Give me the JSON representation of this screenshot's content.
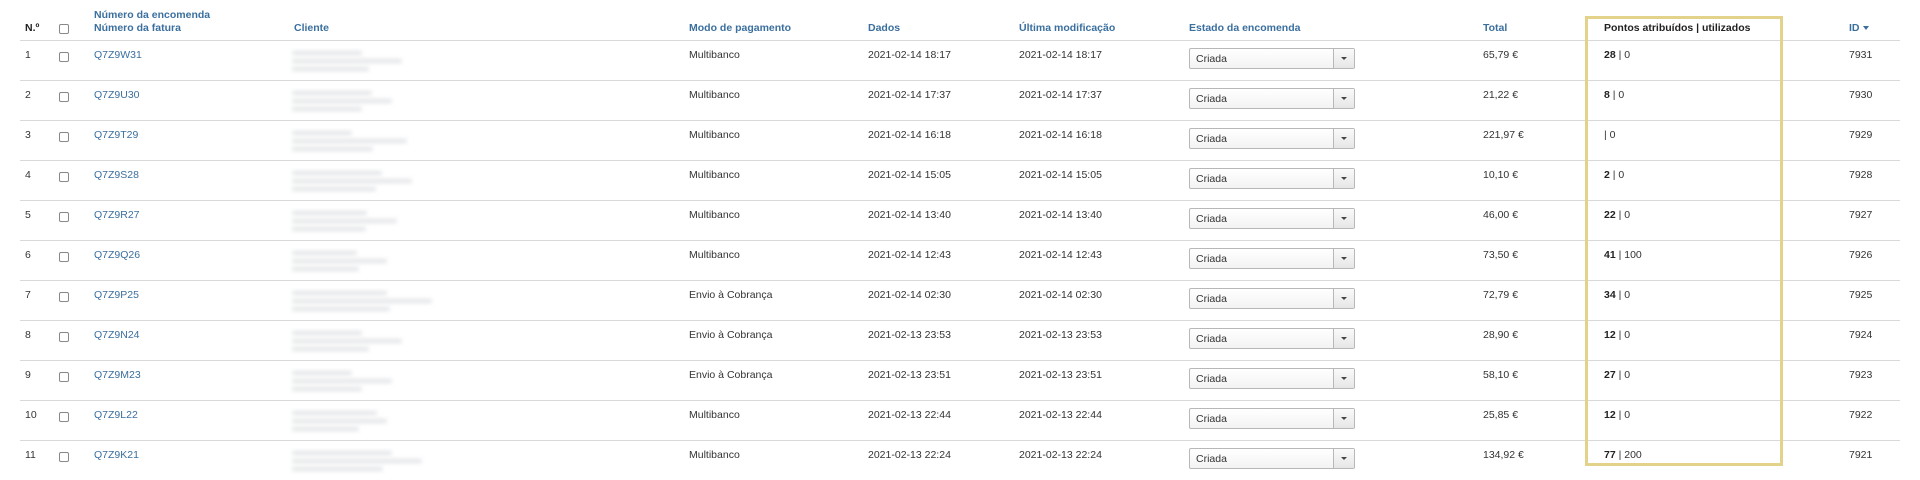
{
  "headers": {
    "num": "N.º",
    "order_number": "Número da encomenda",
    "invoice_number": "Número da fatura",
    "client": "Cliente",
    "payment": "Modo de pagamento",
    "date": "Dados",
    "modified": "Última modificação",
    "status": "Estado da encomenda",
    "total": "Total",
    "points": "Pontos atribuídos | utilizados",
    "id": "ID"
  },
  "rows": [
    {
      "num": "1",
      "order": "Q7Z9W31",
      "payment": "Multibanco",
      "date": "2021-02-14 18:17",
      "modified": "2021-02-14 18:17",
      "status": "Criada",
      "total": "65,79 €",
      "awarded": "28",
      "used": "| 0",
      "id": "7931"
    },
    {
      "num": "2",
      "order": "Q7Z9U30",
      "payment": "Multibanco",
      "date": "2021-02-14 17:37",
      "modified": "2021-02-14 17:37",
      "status": "Criada",
      "total": "21,22 €",
      "awarded": "8",
      "used": "| 0",
      "id": "7930"
    },
    {
      "num": "3",
      "order": "Q7Z9T29",
      "payment": "Multibanco",
      "date": "2021-02-14 16:18",
      "modified": "2021-02-14 16:18",
      "status": "Criada",
      "total": "221,97 €",
      "awarded": "",
      "used": "| 0",
      "id": "7929"
    },
    {
      "num": "4",
      "order": "Q7Z9S28",
      "payment": "Multibanco",
      "date": "2021-02-14 15:05",
      "modified": "2021-02-14 15:05",
      "status": "Criada",
      "total": "10,10 €",
      "awarded": "2",
      "used": "| 0",
      "id": "7928"
    },
    {
      "num": "5",
      "order": "Q7Z9R27",
      "payment": "Multibanco",
      "date": "2021-02-14 13:40",
      "modified": "2021-02-14 13:40",
      "status": "Criada",
      "total": "46,00 €",
      "awarded": "22",
      "used": "| 0",
      "id": "7927"
    },
    {
      "num": "6",
      "order": "Q7Z9Q26",
      "payment": "Multibanco",
      "date": "2021-02-14 12:43",
      "modified": "2021-02-14 12:43",
      "status": "Criada",
      "total": "73,50 €",
      "awarded": "41",
      "used": "| 100",
      "id": "7926"
    },
    {
      "num": "7",
      "order": "Q7Z9P25",
      "payment": "Envio à Cobrança",
      "date": "2021-02-14 02:30",
      "modified": "2021-02-14 02:30",
      "status": "Criada",
      "total": "72,79 €",
      "awarded": "34",
      "used": "| 0",
      "id": "7925"
    },
    {
      "num": "8",
      "order": "Q7Z9N24",
      "payment": "Envio à Cobrança",
      "date": "2021-02-13 23:53",
      "modified": "2021-02-13 23:53",
      "status": "Criada",
      "total": "28,90 €",
      "awarded": "12",
      "used": "| 0",
      "id": "7924"
    },
    {
      "num": "9",
      "order": "Q7Z9M23",
      "payment": "Envio à Cobrança",
      "date": "2021-02-13 23:51",
      "modified": "2021-02-13 23:51",
      "status": "Criada",
      "total": "58,10 €",
      "awarded": "27",
      "used": "| 0",
      "id": "7923"
    },
    {
      "num": "10",
      "order": "Q7Z9L22",
      "payment": "Multibanco",
      "date": "2021-02-13 22:44",
      "modified": "2021-02-13 22:44",
      "status": "Criada",
      "total": "25,85 €",
      "awarded": "12",
      "used": "| 0",
      "id": "7922"
    },
    {
      "num": "11",
      "order": "Q7Z9K21",
      "payment": "Multibanco",
      "date": "2021-02-13 22:24",
      "modified": "2021-02-13 22:24",
      "status": "Criada",
      "total": "134,92 €",
      "awarded": "77",
      "used": "| 200",
      "id": "7921"
    }
  ],
  "colors": {
    "link": "#3a6f9e",
    "highlight_border": "#e3d28a",
    "row_divider": "#d9d9d9"
  },
  "icons": {
    "sort": "sort-desc-caret-icon",
    "dropdown": "chevron-down-icon"
  }
}
